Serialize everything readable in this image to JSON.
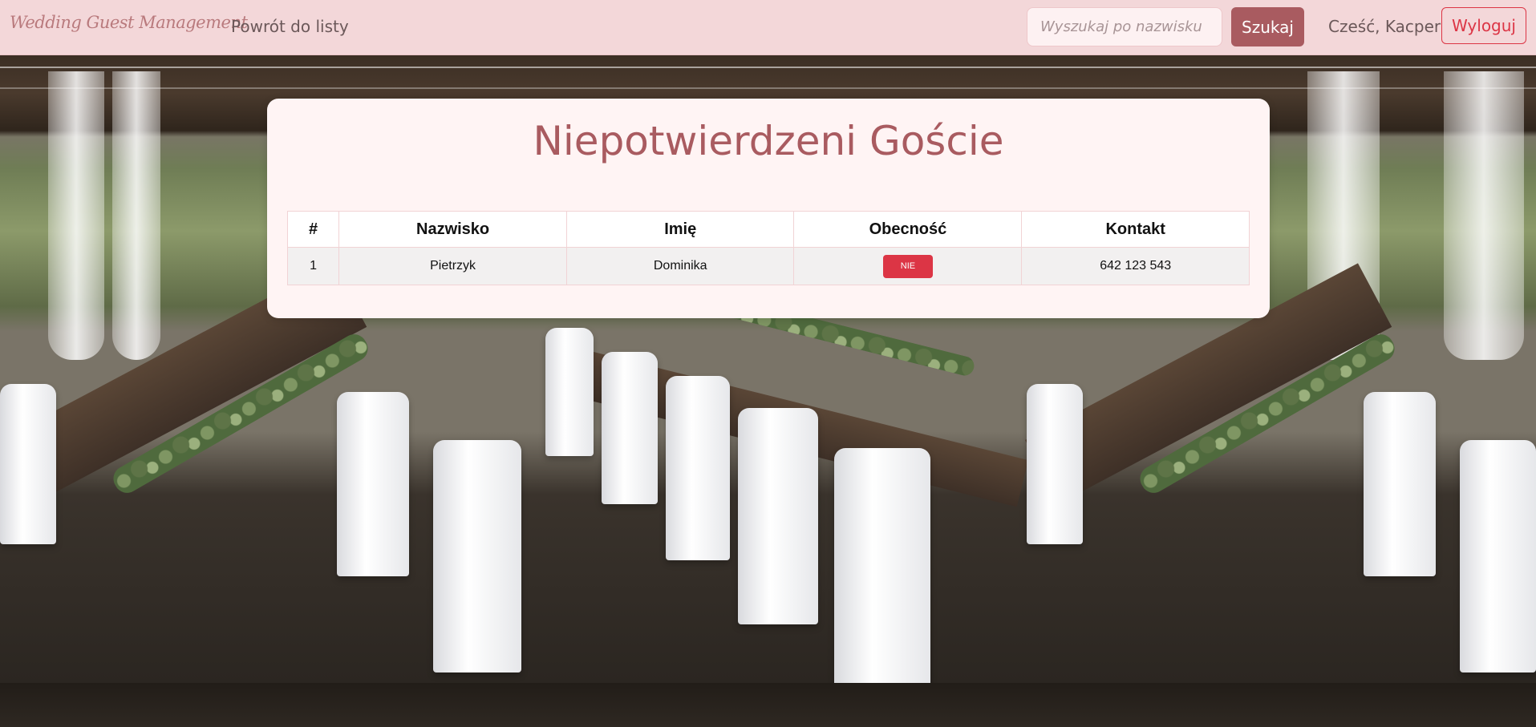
{
  "navbar": {
    "brand": "Wedding Guest Management",
    "back_link": "Powrót do listy",
    "search_placeholder": "Wyszukaj po nazwisku",
    "search_value": "",
    "search_button": "Szukaj",
    "greeting": "Cześć, Kacper",
    "logout_button": "Wyloguj"
  },
  "page": {
    "title": "Niepotwierdzeni Goście"
  },
  "table": {
    "headers": [
      "#",
      "Nazwisko",
      "Imię",
      "Obecność",
      "Kontakt"
    ],
    "rows": [
      {
        "num": "1",
        "surname": "Pietrzyk",
        "name": "Dominika",
        "attendance": "NIE",
        "contact": "642 123 543"
      }
    ]
  },
  "colors": {
    "navbar_bg": "#f3d7d9",
    "accent": "#a95b60",
    "danger": "#dc3545",
    "card_bg": "#fff4f4"
  },
  "background": {
    "description_icon": "wedding-reception-photo"
  }
}
